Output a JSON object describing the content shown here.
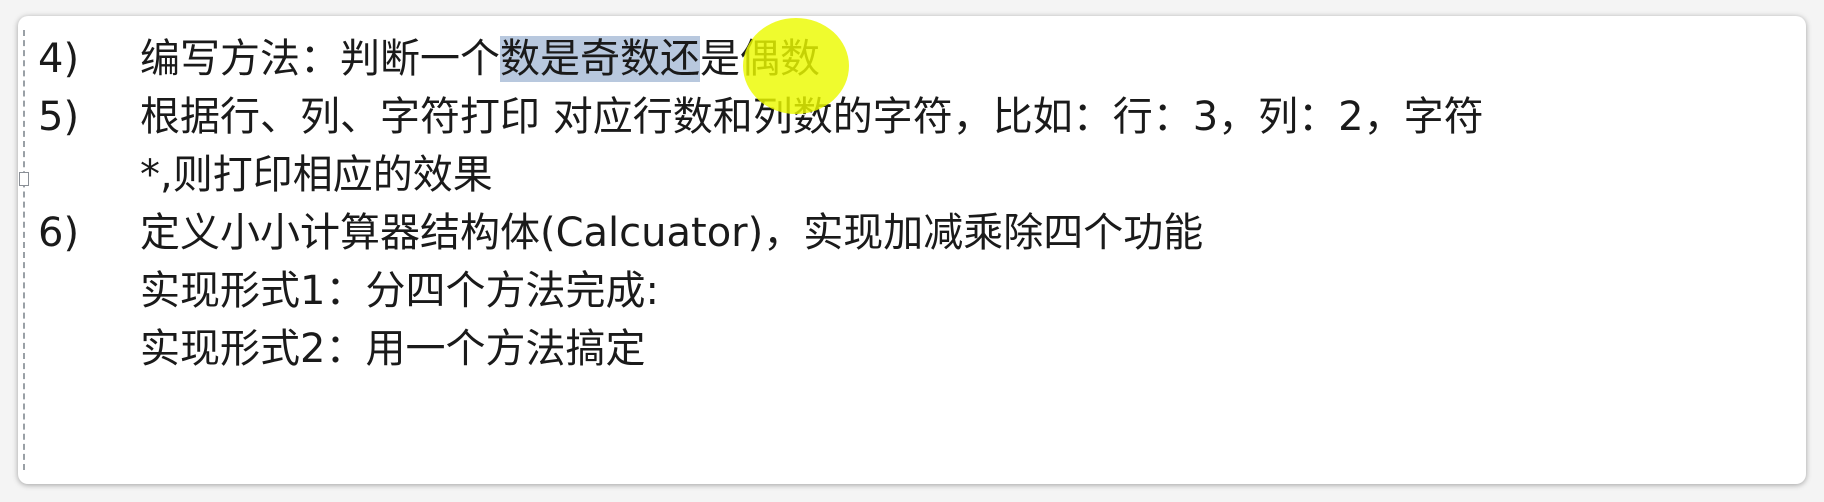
{
  "document": {
    "items": [
      {
        "number": "4)",
        "text_before": "编写方法：判断一个",
        "text_selected": "数是奇数还",
        "text_after": "是偶数"
      },
      {
        "number": "5)",
        "line1": "根据行、列、字符打印 对应行数和列数的字符，比如：行：3，列：2，字符",
        "line2": "*,则打印相应的效果"
      },
      {
        "number": "6)",
        "line1": "定义小小计算器结构体(Calcuator)，实现加减乘除四个功能",
        "line2": "实现形式1：分四个方法完成:",
        "line3": "实现形式2：用一个方法搞定"
      }
    ]
  },
  "colors": {
    "selection": "#b8c8de",
    "cursor_highlight": "#ecfa00"
  }
}
